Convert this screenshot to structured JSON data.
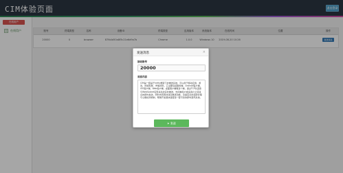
{
  "header": {
    "app_title": "CIM体验页面",
    "right_button": "退出登录"
  },
  "sidebar": {
    "online_button": "在线用户",
    "item_label": "在线用户"
  },
  "table": {
    "columns": [
      "账号",
      "终端类型",
      "名称",
      "设备ID",
      "终端类型",
      "应用版本",
      "系统版本",
      "在线时间",
      "位置",
      "操作"
    ],
    "row": {
      "account": "20000",
      "type": "0",
      "name": "browser",
      "device": "87fb4d50a8f3c21e6d9a7b",
      "channel": "Chrome",
      "app_version": "1.0.0",
      "sys_version": "Windows 10",
      "online": "2019-08-20 10:26",
      "position": "",
      "action": "发送消息"
    }
  },
  "modal": {
    "title": "发送消息",
    "close_glyph": "×",
    "account_label": "接收账号",
    "account_value": "20000",
    "message_label": "消息内容",
    "message_text": "CIM是一套基于netty框架下的推送系统，可以用于移动应用、游戏、智能家居、IM等场景。它主要包括服务端、Android客户端、iOS客户端、Web客户端、桌面客户端等多个端，通过TCP长连接与WebSocket实现消息的实时推送，支持单用户或多用户之间消息的即时发送，同时支持离线消息推送功能，具备完善的连接管理与心跳检测机制，帮助开发者快速搭建一套可靠的即时通讯系统。",
    "send_label": "发送"
  },
  "colors": {
    "topbar": "#2b3643",
    "danger": "#d9534f",
    "primary": "#337ab7",
    "success": "#5cb85c"
  }
}
